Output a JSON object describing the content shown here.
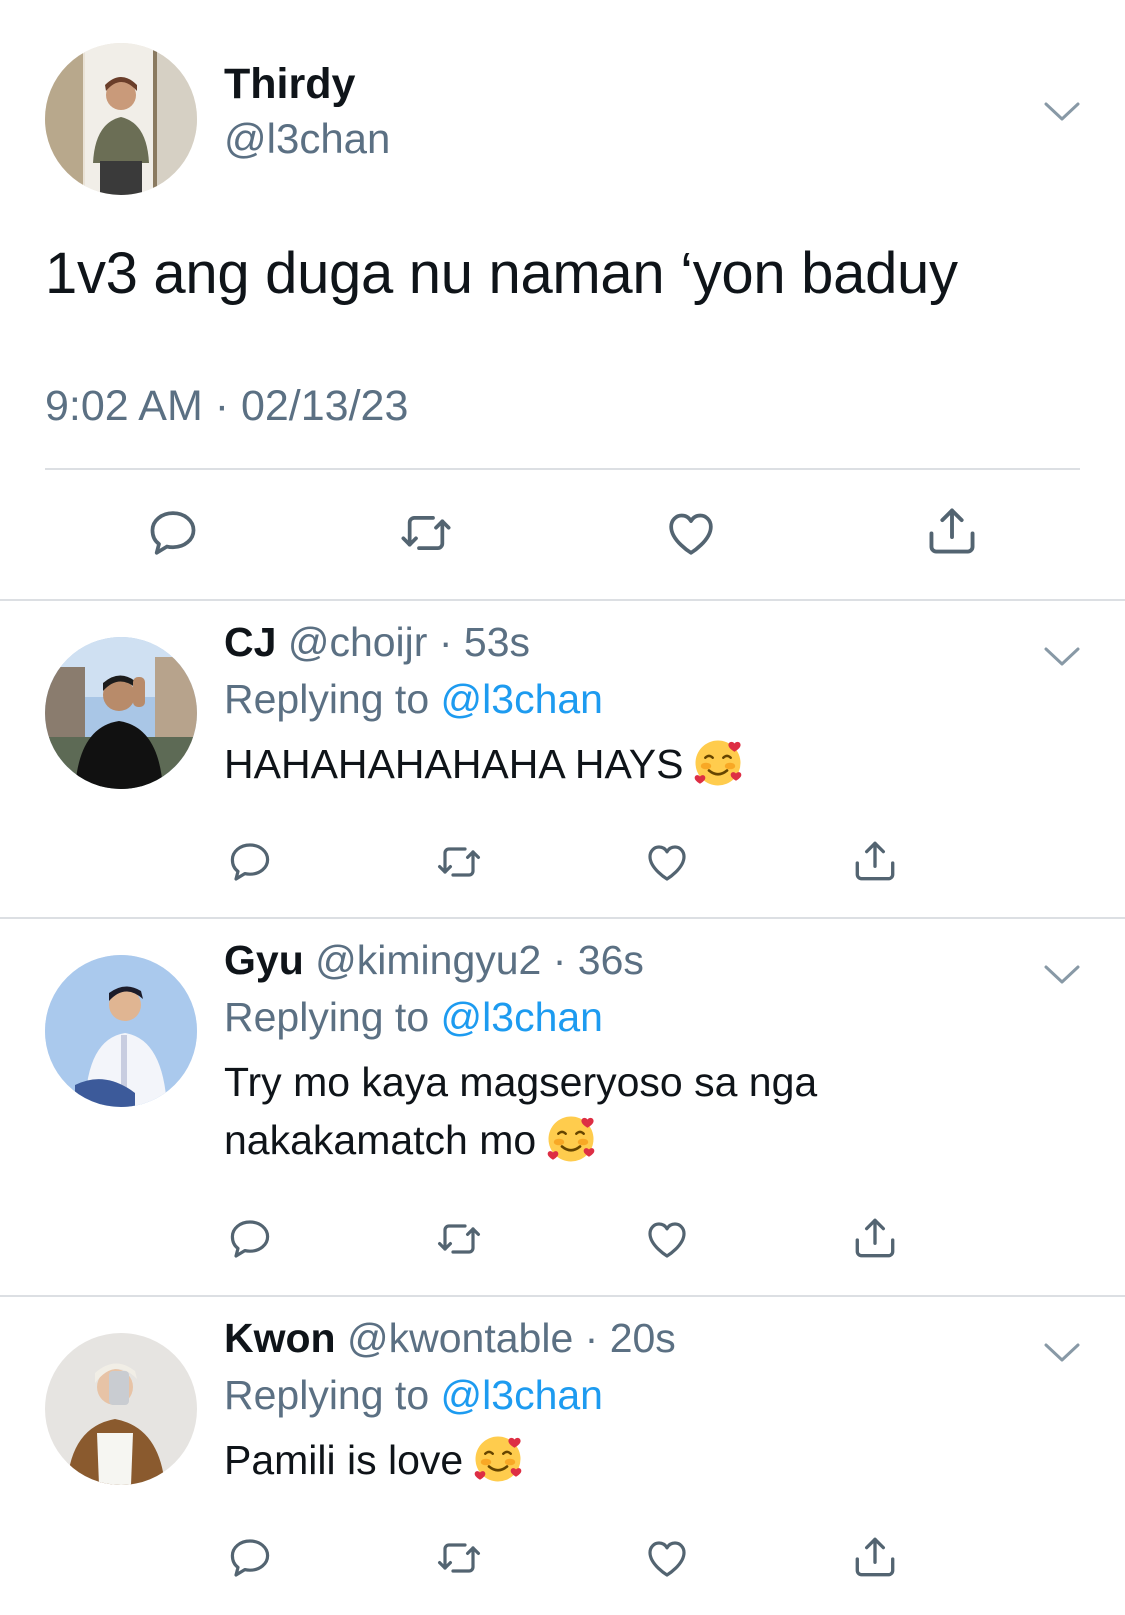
{
  "main_tweet": {
    "name": "Thirdy",
    "handle": "@l3chan",
    "text": "1v3 ang duga nu naman ‘yon baduy",
    "timestamp": "9:02 AM · 02/13/23",
    "avatar_icon": "avatar-photo"
  },
  "replies": [
    {
      "name": "CJ",
      "handle": "@choijr",
      "time": "· 53s",
      "replying_prefix": "Replying to",
      "replying_mention": "@l3chan",
      "text": "HAHAHAHAHAHA HAYS",
      "emoji": "smiling-face-with-hearts"
    },
    {
      "name": "Gyu",
      "handle": "@kimingyu2",
      "time": "· 36s",
      "replying_prefix": "Replying to",
      "replying_mention": "@l3chan",
      "text_line1": "Try mo kaya magseryoso sa nga",
      "text_line2": "nakakamatch mo",
      "emoji": "smiling-face-with-hearts"
    },
    {
      "name": "Kwon",
      "handle": "@kwontable",
      "time": "· 20s",
      "replying_prefix": "Replying to",
      "replying_mention": "@l3chan",
      "text": "Pamili is love",
      "emoji": "smiling-face-with-hearts"
    }
  ],
  "colors": {
    "text": "#0f1419",
    "secondary": "#5b7083",
    "mention": "#1d9bf0",
    "divider": "#dcdfe3"
  }
}
